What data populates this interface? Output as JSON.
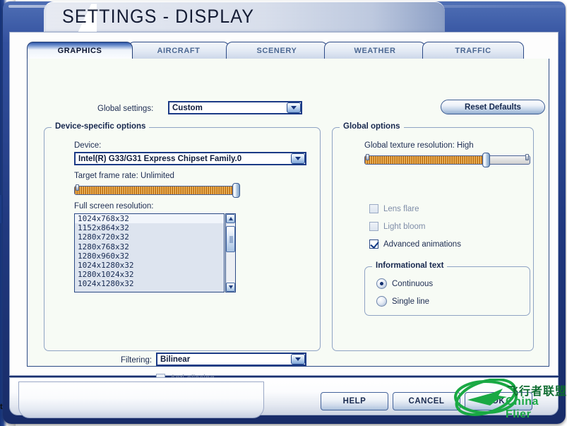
{
  "window": {
    "title": "SETTINGS - DISPLAY",
    "background_window_label": "ts"
  },
  "tabs": [
    {
      "label": "GRAPHICS",
      "active": true
    },
    {
      "label": "AIRCRAFT",
      "active": false
    },
    {
      "label": "SCENERY",
      "active": false
    },
    {
      "label": "WEATHER",
      "active": false
    },
    {
      "label": "TRAFFIC",
      "active": false
    }
  ],
  "global_settings": {
    "label": "Global settings:",
    "value": "Custom"
  },
  "reset_defaults": {
    "label": "Reset Defaults"
  },
  "device_specific": {
    "group_title": "Device-specific options",
    "device_label": "Device:",
    "device_value": "Intel(R) G33/G31 Express Chipset Family.0",
    "frame_rate_label": "Target frame rate: Unlimited",
    "frame_rate_value": "Unlimited",
    "frame_rate_percent": 100,
    "resolution_label": "Full screen resolution:",
    "resolutions": [
      "1024x768x32",
      "1152x864x32",
      "1280x720x32",
      "1280x768x32",
      "1280x960x32",
      "1024x1280x32",
      "1280x1024x32",
      "1024x1280x32"
    ],
    "resolution_selected_index": 0,
    "filtering_label": "Filtering:",
    "filtering_value": "Bilinear",
    "antialiasing": {
      "label": "Anti-aliasing",
      "checked": false,
      "enabled": false
    }
  },
  "global_options": {
    "group_title": "Global options",
    "texture_label": "Global texture resolution: High",
    "texture_value": "High",
    "texture_percent": 74,
    "checkboxes": [
      {
        "label": "Lens flare",
        "checked": false,
        "enabled": false
      },
      {
        "label": "Light bloom",
        "checked": false,
        "enabled": false
      },
      {
        "label": "Advanced animations",
        "checked": true,
        "enabled": true
      }
    ],
    "informational_text": {
      "group_title": "Informational text",
      "options": [
        {
          "label": "Continuous",
          "selected": true
        },
        {
          "label": "Single line",
          "selected": false
        }
      ]
    }
  },
  "bottom_buttons": [
    {
      "label": "HELP"
    },
    {
      "label": "CANCEL"
    },
    {
      "label": "OK"
    }
  ],
  "watermark": {
    "chinese": "飞行者联盟",
    "english": "China Flier",
    "color": "#1aa944"
  },
  "colors": {
    "shell_blue": "#20387e",
    "accent_blue": "#2c4a86",
    "panel_bg": "#f7fbf5",
    "slider_fill": "#d9912c"
  }
}
